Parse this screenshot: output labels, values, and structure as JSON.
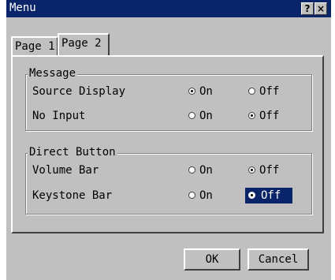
{
  "window": {
    "title": "Menu",
    "help_label": "?",
    "close_label": "×"
  },
  "tabs": [
    {
      "label": "Page 1",
      "selected": false
    },
    {
      "label": "Page 2",
      "selected": true
    }
  ],
  "message_group": {
    "title": "Message",
    "rows": [
      {
        "label": "Source Display",
        "on_label": "On",
        "off_label": "Off",
        "value": "On"
      },
      {
        "label": "No Input",
        "on_label": "On",
        "off_label": "Off",
        "value": "Off"
      }
    ]
  },
  "direct_button_group": {
    "title": "Direct Button",
    "rows": [
      {
        "label": "Volume Bar",
        "on_label": "On",
        "off_label": "Off",
        "value": "Off"
      },
      {
        "label": "Keystone Bar",
        "on_label": "On",
        "off_label": "Off",
        "value": "Off",
        "focused": "Off"
      }
    ]
  },
  "buttons": {
    "ok_label": "OK",
    "cancel_label": "Cancel"
  },
  "colors": {
    "title_bar": "#0a246a",
    "face": "#c0c0c0",
    "focus": "#0a246a"
  }
}
